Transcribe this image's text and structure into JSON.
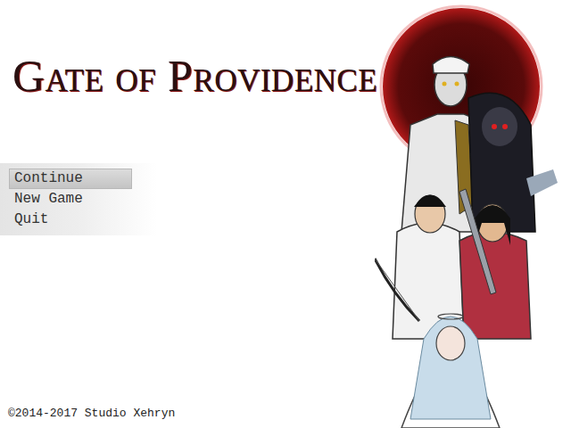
{
  "title": "Gate of Providence",
  "menu": [
    {
      "label": "Continue",
      "selected": true
    },
    {
      "label": "New Game",
      "selected": false
    },
    {
      "label": "Quit",
      "selected": false
    }
  ],
  "copyright": "©2014-2017 Studio Xehryn"
}
